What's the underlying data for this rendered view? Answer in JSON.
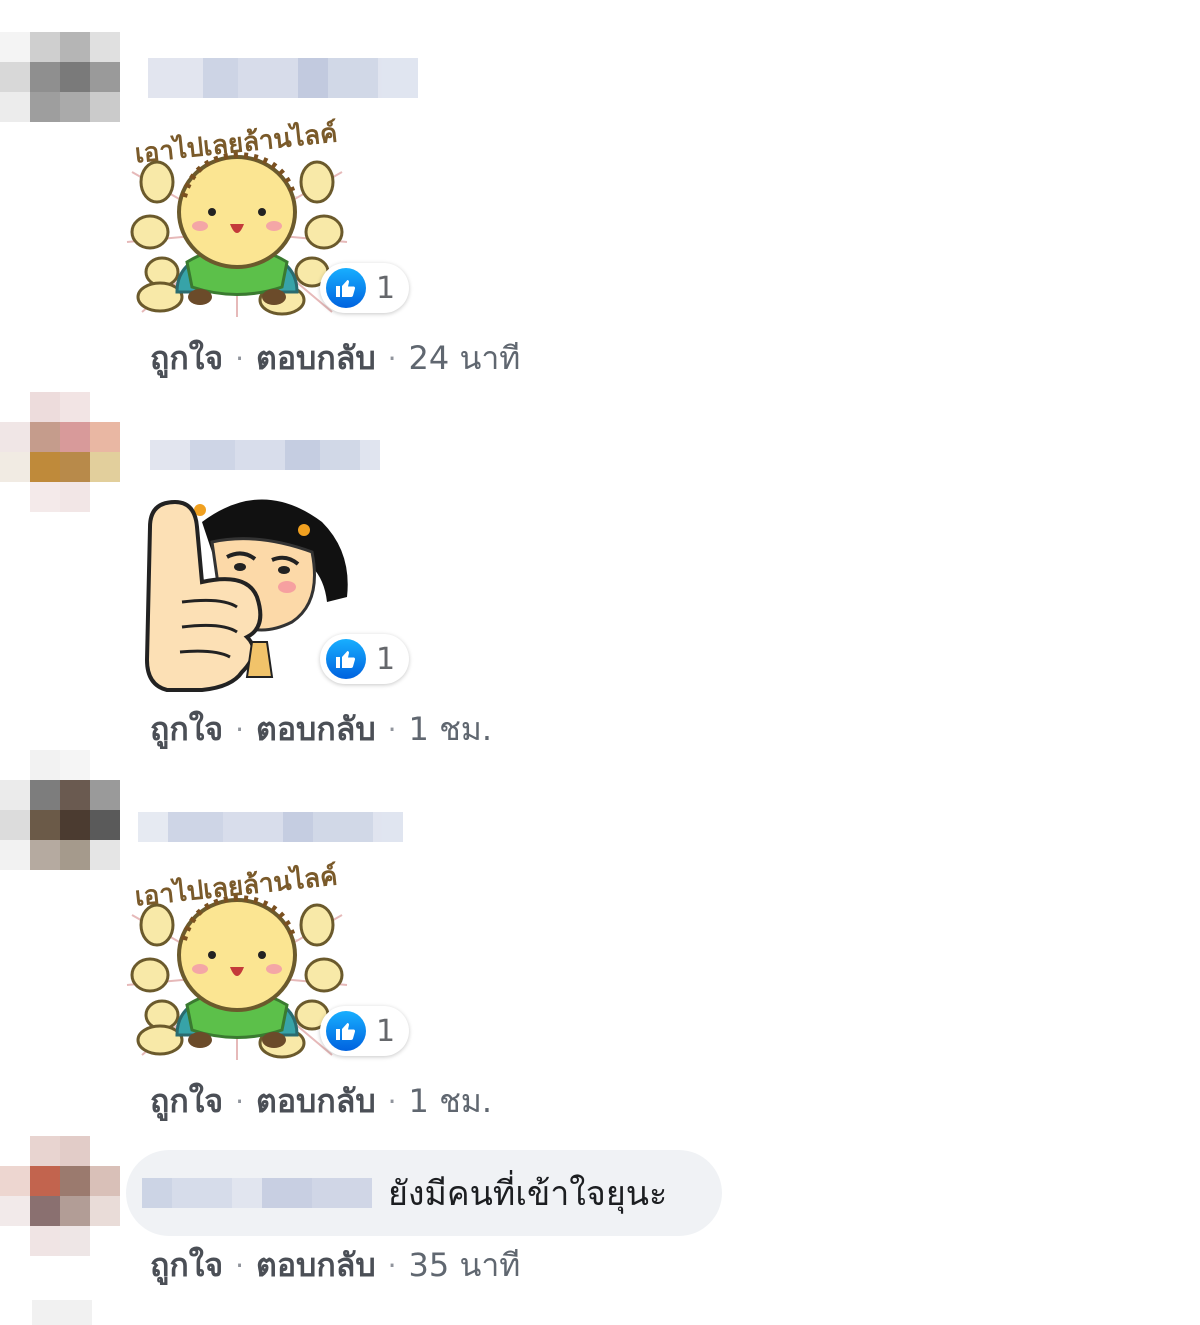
{
  "comments": [
    {
      "sticker": {
        "caption": "เอาไปเลยล้านไลค์",
        "icon": "sticker-chick-million-likes"
      },
      "like_count": "1",
      "actions": {
        "like": "ถูกใจ",
        "reply": "ตอบกลับ",
        "separator": "·",
        "time": "24 นาที"
      }
    },
    {
      "sticker": {
        "icon": "sticker-girl-thumbs-up"
      },
      "like_count": "1",
      "actions": {
        "like": "ถูกใจ",
        "reply": "ตอบกลับ",
        "separator": "·",
        "time": "1 ชม."
      }
    },
    {
      "sticker": {
        "caption": "เอาไปเลยล้านไลค์",
        "icon": "sticker-chick-million-likes"
      },
      "like_count": "1",
      "actions": {
        "like": "ถูกใจ",
        "reply": "ตอบกลับ",
        "separator": "·",
        "time": "1 ชม."
      }
    },
    {
      "text": "ยังมีคนที่เข้าใจยุนะ",
      "actions": {
        "like": "ถูกใจ",
        "reply": "ตอบกลับ",
        "separator": "·",
        "time": "35 นาที"
      }
    }
  ],
  "colors": {
    "like_blue": "#1877f2",
    "bubble_bg": "#f0f2f5",
    "meta_text": "#606770"
  }
}
